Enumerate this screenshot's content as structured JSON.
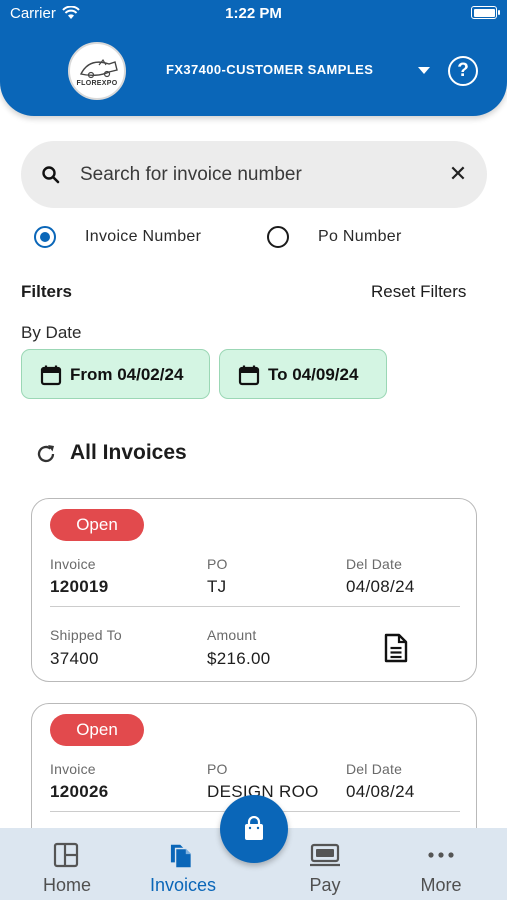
{
  "status_bar": {
    "carrier": "Carrier",
    "time": "1:22 PM"
  },
  "header": {
    "logo_text": "FLOREXPO",
    "account_name": "FX37400-CUSTOMER SAMPLES",
    "help_label": "?"
  },
  "search": {
    "placeholder": "Search for invoice number",
    "value": ""
  },
  "search_mode": {
    "options": [
      {
        "label": "Invoice Number",
        "selected": true
      },
      {
        "label": "Po Number",
        "selected": false
      }
    ]
  },
  "filters": {
    "title": "Filters",
    "reset_label": "Reset Filters",
    "by_date_label": "By Date",
    "from_label": "From 04/02/24",
    "to_label": "To 04/09/24"
  },
  "invoices": {
    "title": "All Invoices",
    "field_labels": {
      "invoice": "Invoice",
      "po": "PO",
      "del_date": "Del Date",
      "shipped_to": "Shipped To",
      "amount": "Amount"
    },
    "items": [
      {
        "status": "Open",
        "invoice": "120019",
        "po": "TJ",
        "del_date": "04/08/24",
        "shipped_to": "37400",
        "amount": "$216.00"
      },
      {
        "status": "Open",
        "invoice": "120026",
        "po": "DESIGN ROO",
        "del_date": "04/08/24"
      }
    ]
  },
  "colors": {
    "primary": "#0a66b8",
    "status_open": "#e24a4d",
    "date_chip": "#d4f5e3",
    "nav_bg": "#dce6f0"
  },
  "bottom_nav": {
    "items": [
      {
        "label": "Home",
        "icon": "home-icon",
        "active": false
      },
      {
        "label": "Invoices",
        "icon": "invoices-icon",
        "active": true
      },
      {
        "label": "Pay",
        "icon": "pay-icon",
        "active": false
      },
      {
        "label": "More",
        "icon": "more-icon",
        "active": false
      }
    ],
    "fab_icon": "shopping-bag-icon"
  }
}
